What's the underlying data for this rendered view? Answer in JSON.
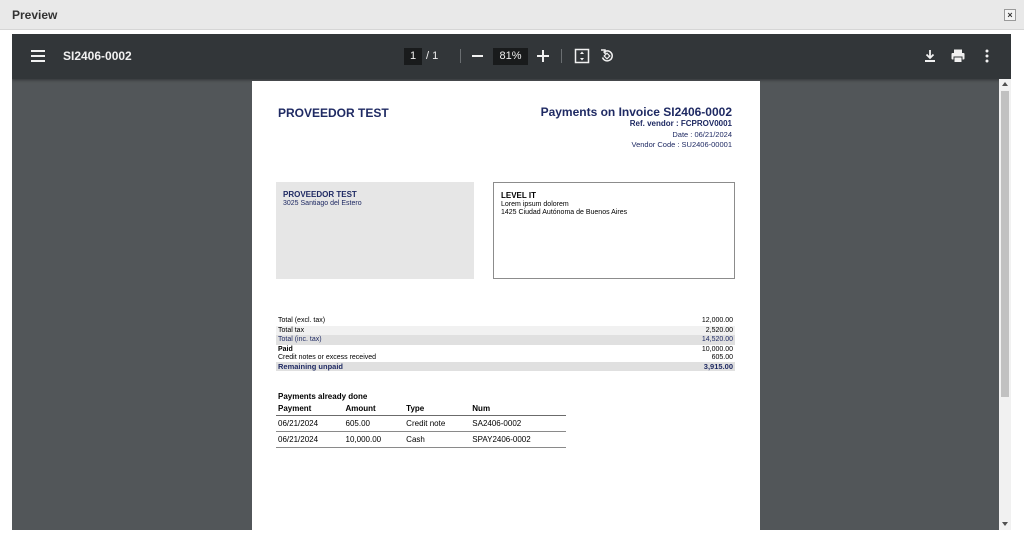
{
  "dialog": {
    "title": "Preview",
    "close_label": "×"
  },
  "toolbar": {
    "doc_title": "SI2406-0002",
    "page_current": "1",
    "page_separator": "/ 1",
    "zoom_value": "81%",
    "icons": [
      "menu-icon",
      "zoom-out-icon",
      "zoom-in-icon",
      "fit-page-icon",
      "rotate-icon",
      "download-icon",
      "print-icon",
      "more-icon"
    ]
  },
  "invoice": {
    "supplier": "PROVEEDOR TEST",
    "title": "Payments on Invoice SI2406-0002",
    "ref_vendor": "Ref. vendor : FCPROV0001",
    "date": "Date : 06/21/2024",
    "vendor_code": "Vendor Code : SU2406-00001",
    "from": {
      "name": "PROVEEDOR TEST",
      "line1": "3025 Santiago del Estero"
    },
    "to": {
      "name": "LEVEL IT",
      "line1": "Lorem ipsum dolorem",
      "line2": "1425 Ciudad Autónoma de Buenos Aires"
    },
    "totals": [
      {
        "label": "Total (excl. tax)",
        "value": "12,000.00"
      },
      {
        "label": "Total tax",
        "value": "2,520.00"
      },
      {
        "label": "Total (inc. tax)",
        "value": "14,520.00"
      },
      {
        "label": "Paid",
        "value": "10,000.00"
      },
      {
        "label": "Credit notes or excess received",
        "value": "605.00"
      },
      {
        "label": "Remaining unpaid",
        "value": "3,915.00"
      }
    ],
    "payments_title": "Payments already done",
    "payments_headers": [
      "Payment",
      "Amount",
      "Type",
      "Num"
    ],
    "payments": [
      {
        "payment": "06/21/2024",
        "amount": "605.00",
        "type": "Credit note",
        "num": "SA2406-0002"
      },
      {
        "payment": "06/21/2024",
        "amount": "10,000.00",
        "type": "Cash",
        "num": "SPAY2406-0002"
      }
    ]
  },
  "colors": {
    "toolbar_bg": "#323639",
    "viewer_bg": "#525659",
    "invoice_navy": "#1f2a63"
  }
}
